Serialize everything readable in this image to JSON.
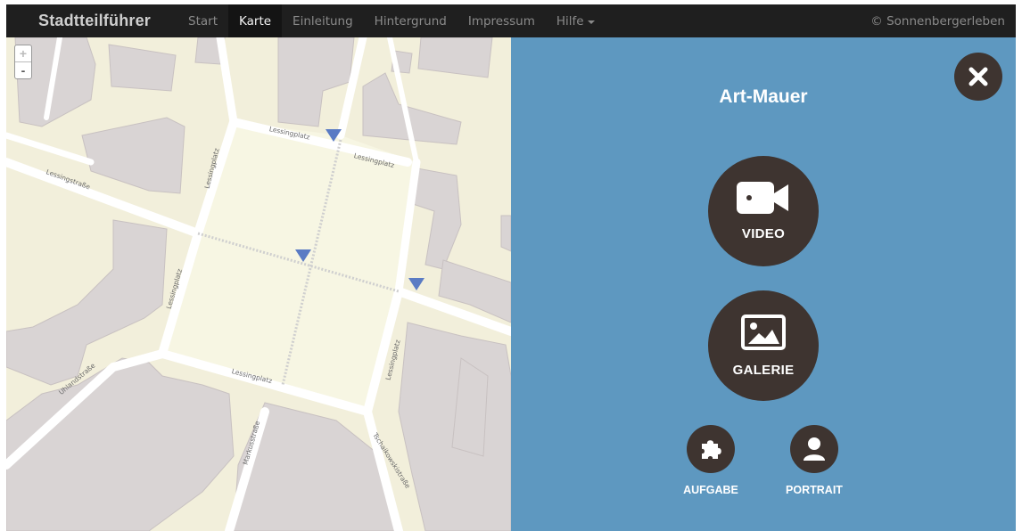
{
  "navbar": {
    "brand": "Stadtteilführer",
    "links": [
      "Start",
      "Karte",
      "Einleitung",
      "Hintergrund",
      "Impressum",
      "Hilfe"
    ],
    "active": "Karte",
    "copyright": "© Sonnenbergerleben"
  },
  "map": {
    "zoom_in": "+",
    "zoom_out": "-",
    "streets": [
      "Lessingplatz",
      "Lessingplatz",
      "Lessingstraße",
      "Lessingplatz",
      "Lessingplatz",
      "Lessingplatz",
      "Lessingplatz",
      "Uhlandstraße",
      "Markusstraße",
      "Tschaikowskistraße"
    ],
    "marker_color": "#5a7bc4"
  },
  "panel": {
    "title": "Art-Mauer",
    "video_label": "VIDEO",
    "gallery_label": "GALERIE",
    "task_label": "AUFGABE",
    "portrait_label": "PORTRAIT",
    "background": "#5e98c0",
    "button_color": "#3e3430"
  }
}
